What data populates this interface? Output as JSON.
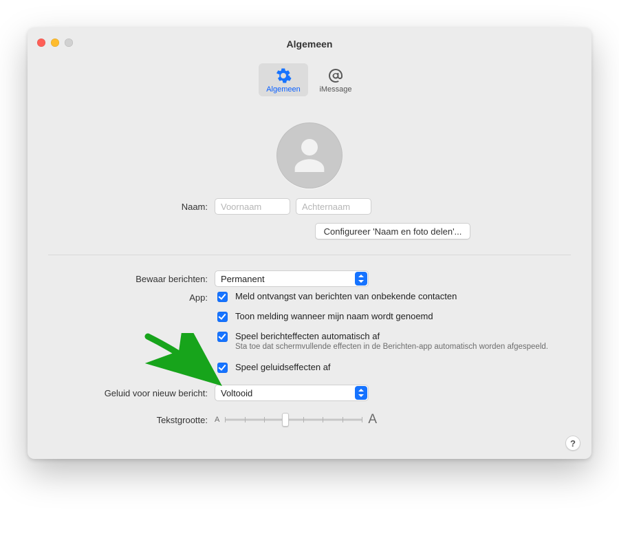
{
  "window": {
    "title": "Algemeen"
  },
  "tabs": {
    "general": "Algemeen",
    "imessage": "iMessage"
  },
  "profile": {
    "name_label": "Naam:",
    "first_placeholder": "Voornaam",
    "last_placeholder": "Achternaam",
    "share_button": "Configureer 'Naam en foto delen'..."
  },
  "settings": {
    "keep_label": "Bewaar berichten:",
    "keep_value": "Permanent",
    "app_label": "App:",
    "checks": {
      "unknown": "Meld ontvangst van berichten van onbekende contacten",
      "name_mentioned": "Toon melding wanneer mijn naam wordt genoemd",
      "autoplay_effects": "Speel berichteffecten automatisch af",
      "autoplay_note": "Sta toe dat schermvullende effecten in de Berichten-app automatisch worden afgespeeld.",
      "sound_effects": "Speel geluidseffecten af"
    },
    "sound_label": "Geluid voor nieuw bericht:",
    "sound_value": "Voltooid",
    "textsize_label": "Tekstgrootte:",
    "small_a": "A",
    "big_a": "A"
  },
  "help": "?"
}
